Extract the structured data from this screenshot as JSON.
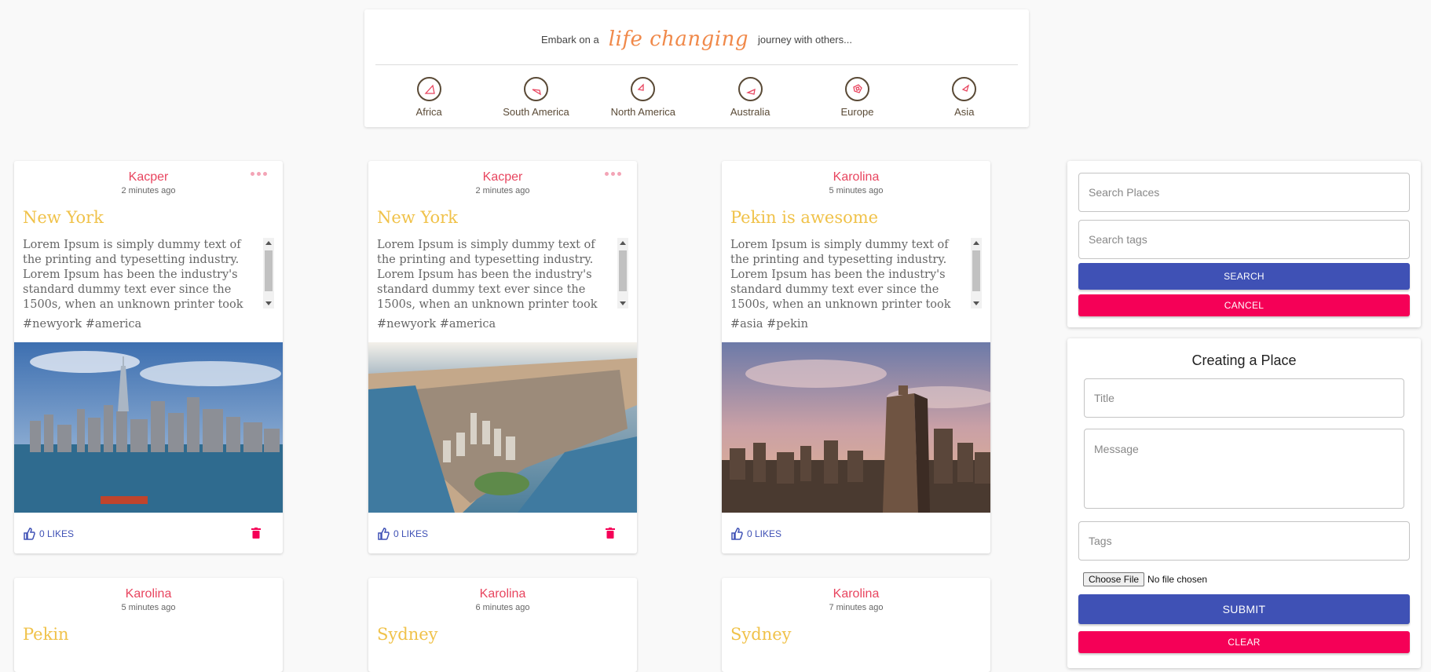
{
  "header": {
    "tagline_before": "Embark on a",
    "tagline_highlight": "life changing",
    "tagline_after": "journey with others...",
    "continents": [
      "Africa",
      "South America",
      "North America",
      "Australia",
      "Europe",
      "Asia"
    ]
  },
  "cards": [
    {
      "author": "Kacper",
      "time": "2 minutes ago",
      "title": "New York",
      "message": "Lorem Ipsum is simply dummy text of the printing and typesetting industry. Lorem Ipsum has been the industry's standard dummy text ever since the 1500s, when an unknown printer took a galley of type and scrambled it to make a type specimen book.",
      "tags": "#newyork #america",
      "likes": "0 LIKES"
    },
    {
      "author": "Kacper",
      "time": "2 minutes ago",
      "title": "New York",
      "message": "Lorem Ipsum is simply dummy text of the printing and typesetting industry. Lorem Ipsum has been the industry's standard dummy text ever since the 1500s, when an unknown printer took a galley of type and scrambled it to make a type specimen book.",
      "tags": "#newyork #america",
      "likes": "0 LIKES"
    },
    {
      "author": "Karolina",
      "time": "5 minutes ago",
      "title": "Pekin is awesome",
      "message": "Lorem Ipsum is simply dummy text of the printing and typesetting industry. Lorem Ipsum has been the industry's standard dummy text ever since the 1500s, when an unknown printer took a galley of type and scrambled it to make a type specimen book.",
      "tags": "#asia #pekin",
      "likes": "0 LIKES"
    },
    {
      "author": "Karolina",
      "time": "5 minutes ago",
      "title": "Pekin"
    },
    {
      "author": "Karolina",
      "time": "6 minutes ago",
      "title": "Sydney"
    },
    {
      "author": "Karolina",
      "time": "7 minutes ago",
      "title": "Sydney"
    }
  ],
  "search": {
    "places_placeholder": "Search Places",
    "tags_placeholder": "Search tags",
    "search_label": "SEARCH",
    "cancel_label": "CANCEL"
  },
  "create": {
    "title": "Creating a Place",
    "title_placeholder": "Title",
    "message_placeholder": "Message",
    "tags_placeholder": "Tags",
    "file_button": "Choose File",
    "file_status": "No file chosen",
    "submit_label": "SUBMIT",
    "clear_label": "CLEAR"
  },
  "colors": {
    "author": "#e8455f",
    "title": "#f0c24a",
    "primary": "#3f51b5",
    "secondary": "#f50057"
  }
}
